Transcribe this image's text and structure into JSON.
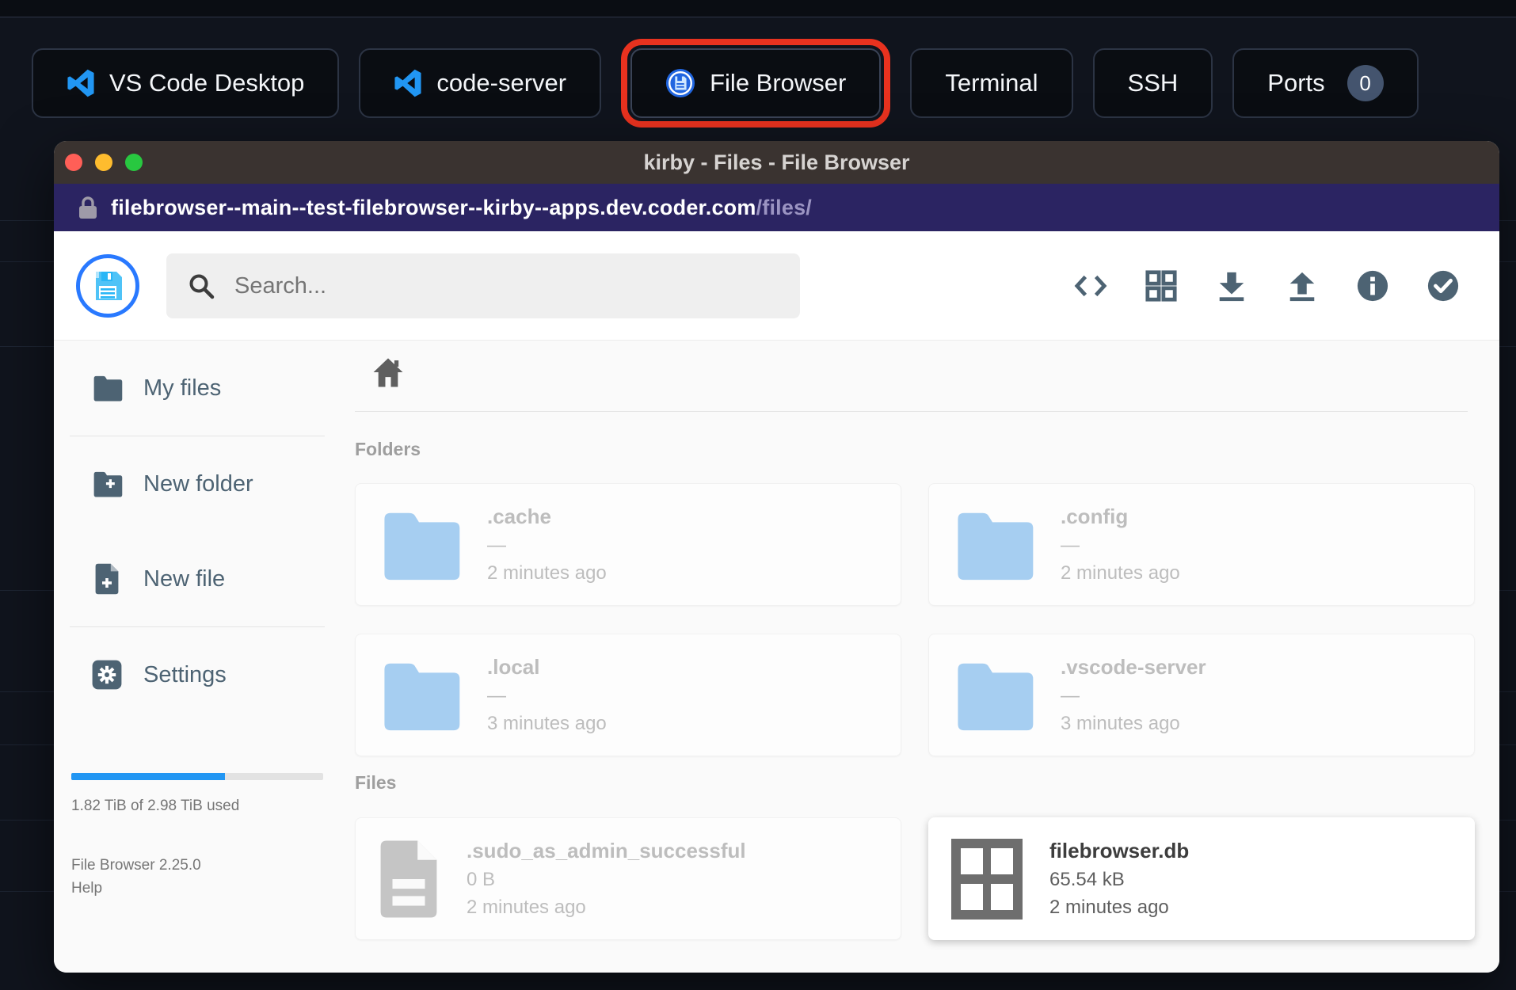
{
  "taskbar": {
    "tabs": [
      {
        "label": "VS Code Desktop",
        "icon": "vscode-icon"
      },
      {
        "label": "code-server",
        "icon": "vscode-icon"
      },
      {
        "label": "File Browser",
        "icon": "filebrowser-icon",
        "highlighted": true
      },
      {
        "label": "Terminal"
      },
      {
        "label": "SSH"
      },
      {
        "label": "Ports",
        "badge": "0"
      }
    ]
  },
  "window": {
    "title": "kirby - Files - File Browser",
    "url": {
      "domain": "filebrowser--main--test-filebrowser--kirby--apps.dev.coder.com",
      "path": "/files/"
    }
  },
  "header": {
    "search_placeholder": "Search...",
    "icons": [
      "code-icon",
      "grid-view-icon",
      "download-icon",
      "upload-icon",
      "info-icon",
      "check-circle-icon"
    ]
  },
  "sidebar": {
    "items": [
      {
        "label": "My files",
        "icon": "folder-icon"
      },
      {
        "label": "New folder",
        "icon": "folder-plus-icon"
      },
      {
        "label": "New file",
        "icon": "file-plus-icon"
      },
      {
        "label": "Settings",
        "icon": "gear-icon"
      }
    ],
    "storage": {
      "used_percent": 61,
      "label": "1.82 TiB of 2.98 TiB used"
    },
    "footer": {
      "version": "File Browser 2.25.0",
      "help": "Help"
    }
  },
  "content": {
    "breadcrumb_icon": "home-icon",
    "sections": [
      {
        "heading": "Folders",
        "items": [
          {
            "name": ".cache",
            "size": "—",
            "modified": "2 minutes ago",
            "type": "folder",
            "muted": true
          },
          {
            "name": ".config",
            "size": "—",
            "modified": "2 minutes ago",
            "type": "folder",
            "muted": true
          },
          {
            "name": ".local",
            "size": "—",
            "modified": "3 minutes ago",
            "type": "folder",
            "muted": true
          },
          {
            "name": ".vscode-server",
            "size": "—",
            "modified": "3 minutes ago",
            "type": "folder",
            "muted": true
          }
        ]
      },
      {
        "heading": "Files",
        "items": [
          {
            "name": ".sudo_as_admin_successful",
            "size": "0 B",
            "modified": "2 minutes ago",
            "type": "file",
            "muted": true
          },
          {
            "name": "filebrowser.db",
            "size": "65.54 kB",
            "modified": "2 minutes ago",
            "type": "database",
            "muted": false,
            "selected": true
          }
        ]
      }
    ]
  },
  "colors": {
    "accent_blue": "#2196f3",
    "highlight_red": "#e8321f",
    "folder_blue": "#a6cef1",
    "slate_icon": "#4d6373",
    "urlbar_purple": "#2b2462",
    "titlebar_brown": "#3a3330"
  }
}
